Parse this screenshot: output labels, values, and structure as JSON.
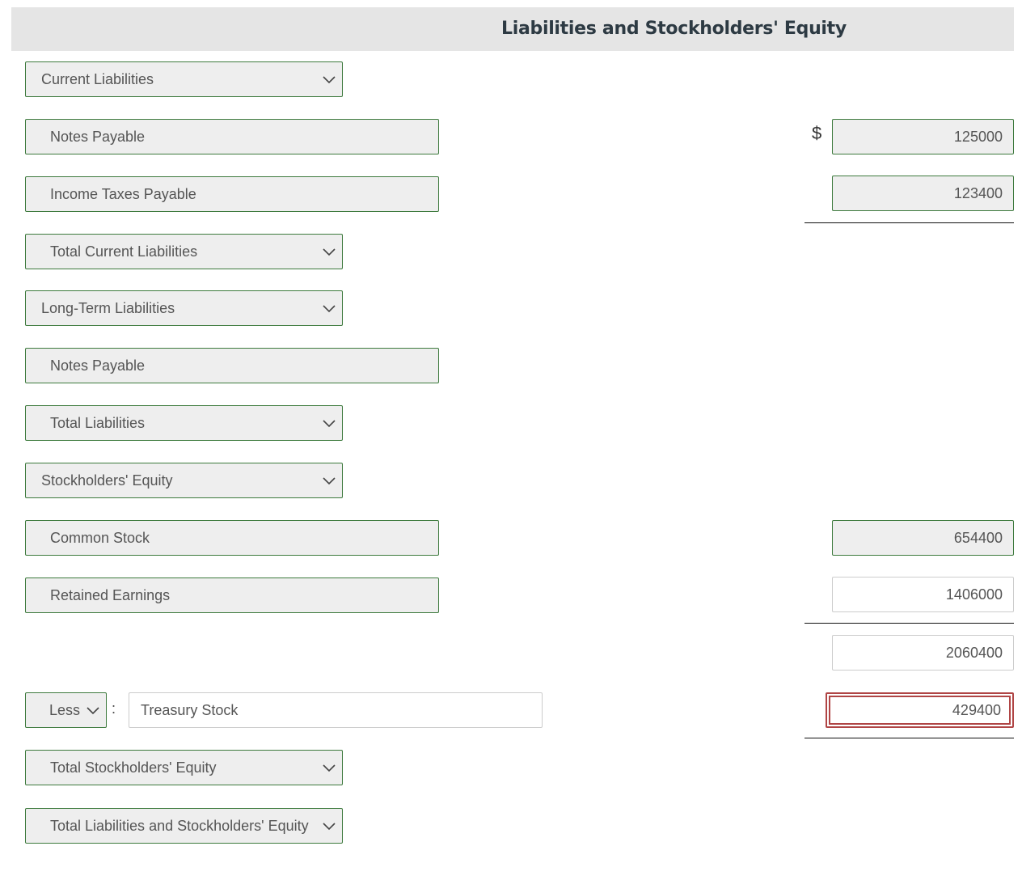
{
  "header": {
    "title": "Liabilities and Stockholders' Equity"
  },
  "currency_symbol": "$",
  "rows": {
    "current_liabilities": {
      "label": "Current Liabilities",
      "type": "select"
    },
    "notes_payable_current": {
      "label": "Notes Payable",
      "amount": "125000"
    },
    "income_taxes_payable": {
      "label": "Income Taxes Payable",
      "amount": "123400"
    },
    "total_current_liabilities": {
      "label": "Total Current Liabilities",
      "type": "select"
    },
    "long_term_liabilities": {
      "label": "Long-Term Liabilities",
      "type": "select"
    },
    "notes_payable_long_term": {
      "label": "Notes Payable"
    },
    "total_liabilities": {
      "label": "Total Liabilities",
      "type": "select"
    },
    "stockholders_equity": {
      "label": "Stockholders' Equity",
      "type": "select"
    },
    "common_stock": {
      "label": "Common Stock",
      "amount": "654400"
    },
    "retained_earnings": {
      "label": "Retained Earnings",
      "amount": "1406000"
    },
    "subtotal": {
      "amount": "2060400"
    },
    "treasury": {
      "operator": "Less",
      "separator": ":",
      "label": "Treasury Stock",
      "amount": "429400",
      "status": "error"
    },
    "total_stockholders_equity": {
      "label": "Total Stockholders' Equity",
      "type": "select"
    },
    "total_liabilities_and_equity": {
      "label": "Total Liabilities and Stockholders' Equity",
      "type": "select"
    }
  },
  "colors": {
    "correct_border": "#3d7a3d",
    "error_border": "#b04545",
    "header_bg": "#e5e5e5"
  }
}
